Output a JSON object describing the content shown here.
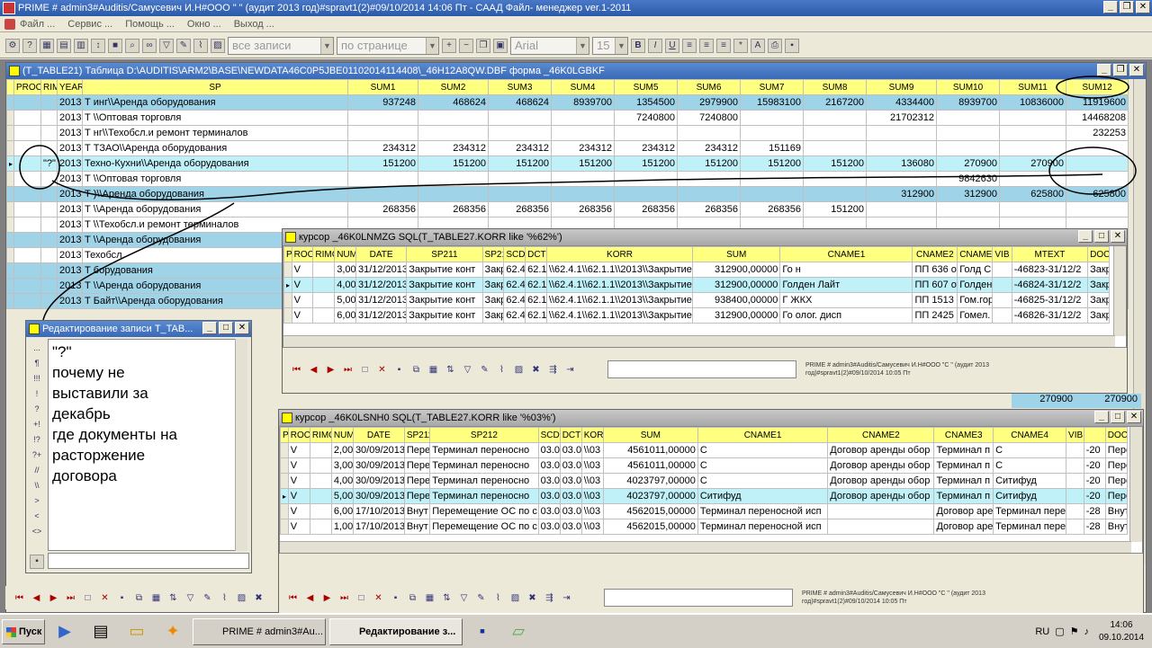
{
  "app": {
    "title": "PRIME # admin3#Auditis/Самусевич И.Н#ООО \"                    \" (аудит 2013 год)#spravt1(2)#09/10/2014 14:06 Пт - СААД Файл- менеджер ver.1-2011"
  },
  "menu": [
    "Файл ...",
    "Сервис ...",
    "Помощь ...",
    "Окно ...",
    "Выход ..."
  ],
  "toolbar": {
    "records": "все записи",
    "page": "по странице",
    "font": "Arial",
    "size": "15"
  },
  "main": {
    "title": "(T_TABLE21) Таблица D:\\AUDITIS\\ARM2\\BASE\\NEWDATA46C0P5JBE01102014114408\\_46H12A8QW.DBF форма _46K0LGBKF",
    "columns": [
      "PROC",
      "RIM",
      "YEAR",
      "SP",
      "SUM1",
      "SUM2",
      "SUM3",
      "SUM4",
      "SUM5",
      "SUM6",
      "SUM7",
      "SUM8",
      "SUM9",
      "SUM10",
      "SUM11",
      "SUM12"
    ],
    "rows": [
      {
        "style": "bl",
        "cells": [
          "",
          "",
          "2013",
          "Т               инг\\\\Аренда оборудования",
          "937248",
          "468624",
          "468624",
          "8939700",
          "1354500",
          "2979900",
          "15983100",
          "2167200",
          "4334400",
          "8939700",
          "10836000",
          "11919600"
        ]
      },
      {
        "style": "",
        "cells": [
          "",
          "",
          "2013",
          "Т                           \\\\Оптовая торговля",
          "",
          "",
          "",
          "",
          "7240800",
          "7240800",
          "",
          "",
          "21702312",
          "",
          "",
          "14468208"
        ]
      },
      {
        "style": "",
        "cells": [
          "",
          "",
          "2013",
          "Т                         нг\\\\Техобсл.и ремонт терминалов",
          "",
          "",
          "",
          "",
          "",
          "",
          "",
          "",
          "",
          "",
          "",
          "232253"
        ]
      },
      {
        "style": "",
        "cells": [
          "",
          "",
          "2013",
          "Т                ТЗАО\\\\Аренда оборудования",
          "234312",
          "234312",
          "234312",
          "234312",
          "234312",
          "234312",
          "151169",
          "",
          "",
          "",
          "",
          ""
        ]
      },
      {
        "style": "hl",
        "cells": [
          "",
          "\"?\"",
          "2013",
          "Техно-Кухни\\\\Аренда оборудования",
          "151200",
          "151200",
          "151200",
          "151200",
          "151200",
          "151200",
          "151200",
          "151200",
          "136080",
          "270900",
          "270900",
          ""
        ]
      },
      {
        "style": "",
        "cells": [
          "",
          "",
          "2013",
          "Т                  \\\\Оптовая торговля",
          "",
          "",
          "",
          "",
          "",
          "",
          "",
          "",
          "",
          "9842630",
          "",
          ""
        ]
      },
      {
        "style": "bl",
        "cells": [
          "",
          "",
          "2013",
          "Т                )\\\\Аренда оборудования",
          "",
          "",
          "",
          "",
          "",
          "",
          "",
          "",
          "312900",
          "312900",
          "625800",
          "625800"
        ]
      },
      {
        "style": "",
        "cells": [
          "",
          "",
          "2013",
          "Т            \\\\Аренда оборудования",
          "268356",
          "268356",
          "268356",
          "268356",
          "268356",
          "268356",
          "268356",
          "151200",
          "",
          "",
          "",
          ""
        ]
      },
      {
        "style": "",
        "cells": [
          "",
          "",
          "2013",
          "Т                \\\\Техобсл.и ремонт терминалов",
          "",
          "",
          "",
          "",
          "",
          "",
          "",
          "",
          "",
          "",
          "",
          ""
        ]
      },
      {
        "style": "bl",
        "cells": [
          "",
          "",
          "2013",
          "Т            \\\\Аренда оборудования",
          "",
          "",
          "",
          "",
          "",
          "",
          "",
          "",
          "",
          "",
          "",
          ""
        ]
      },
      {
        "style": "",
        "cells": [
          "",
          "",
          "2013",
          "Техобсл",
          "",
          "",
          "",
          "",
          "",
          "",
          "",
          "",
          "",
          "",
          "",
          ""
        ]
      },
      {
        "style": "bl",
        "cells": [
          "",
          "",
          "2013",
          "Т                             борудования",
          "",
          "",
          "",
          "",
          "",
          "",
          "",
          "",
          "",
          "",
          "",
          ""
        ]
      },
      {
        "style": "bl",
        "cells": [
          "",
          "",
          "2013",
          "Т        \\\\Аренда оборудования",
          "",
          "",
          "",
          "",
          "",
          "",
          "",
          "",
          "",
          "",
          "",
          ""
        ]
      },
      {
        "style": "bl",
        "cells": [
          "",
          "",
          "2013",
          "Т      Байт\\\\Аренда оборудования",
          "",
          "",
          "",
          "",
          "",
          "",
          "",
          "",
          "",
          "",
          "",
          ""
        ]
      }
    ],
    "row_270900": [
      "270900",
      "270900"
    ]
  },
  "cursor1": {
    "title": "курсор _46K0LNMZG SQL(T_TABLE27.KORR like '%62%')",
    "columns": [
      "P",
      "ROC",
      "RIMC",
      "NUM",
      "DATE",
      "SP211",
      "SP21",
      "SCD",
      "DCT",
      "KORR",
      "SUM",
      "CNAME1",
      "CNAME2",
      "CNAME3",
      "VIB",
      "MTEXT",
      "DOC"
    ],
    "rows": [
      {
        "style": "",
        "cells": [
          "",
          "V",
          "",
          "3,00",
          "31/12/2013",
          "Закрытие конт",
          "Закр",
          "62.4",
          "62.1",
          "\\\\62.4.1\\\\62.1.1\\\\2013\\\\Закрытие",
          "312900,00000",
          "Го              н",
          "ПП 636 от",
          "Голд С",
          "",
          "-46823-31/12/2",
          "Закр"
        ]
      },
      {
        "style": "hl",
        "cells": [
          "▸",
          "V",
          "",
          "4,00",
          "31/12/2013",
          "Закрытие конт",
          "Закр",
          "62.4",
          "62.1",
          "\\\\62.4.1\\\\62.1.1\\\\2013\\\\Закрытие",
          "312900,00000",
          "Голден Лайт",
          "ПП 607 от",
          "Голден",
          "",
          "-46824-31/12/2",
          "Закр"
        ]
      },
      {
        "style": "",
        "cells": [
          "",
          "V",
          "",
          "5,00",
          "31/12/2013",
          "Закрытие конт",
          "Закр",
          "62.4",
          "62.1",
          "\\\\62.4.1\\\\62.1.1\\\\2013\\\\Закрытие",
          "938400,00000",
          "Г                  ЖКХ",
          "ПП 1513 о",
          "Гом.гор",
          "",
          "-46825-31/12/2",
          "Закр"
        ]
      },
      {
        "style": "",
        "cells": [
          "",
          "V",
          "",
          "6,00",
          "31/12/2013",
          "Закрытие конт",
          "Закр",
          "62.4",
          "62.1",
          "\\\\62.4.1\\\\62.1.1\\\\2013\\\\Закрытие",
          "312900,00000",
          "Го            олог. дисп",
          "ПП 2425 о",
          "Гомел.",
          "",
          "-46826-31/12/2",
          "Закр"
        ]
      }
    ],
    "status": "PRIME # admin3#Auditis/Самусевич И.Н#ООО \"С                       \" (аудит 2013 год)#spravt1(2)#09/10/2014 10:05 Пт"
  },
  "cursor2": {
    "title": "курсор _46K0LSNH0 SQL(T_TABLE27.KORR like '%03%')",
    "columns": [
      "P",
      "ROC",
      "RIMC",
      "NUM",
      "DATE",
      "SP211",
      "SP212",
      "SCD",
      "DCT",
      "KORR",
      "SUM",
      "CNAME1",
      "CNAME2",
      "CNAME3",
      "CNAME4",
      "VIB",
      "",
      "DOC"
    ],
    "rows": [
      {
        "style": "",
        "cells": [
          "",
          "V",
          "",
          "2,00",
          "30/09/2013",
          "Пере",
          "Терминал переносно",
          "03.0",
          "03.0",
          "\\\\03",
          "4561011,00000",
          "С       ",
          "Договор аренды обор",
          "Терминал п",
          "С        ",
          "",
          "-20",
          "Пере"
        ]
      },
      {
        "style": "",
        "cells": [
          "",
          "V",
          "",
          "3,00",
          "30/09/2013",
          "Пере",
          "Терминал переносно",
          "03.0",
          "03.0",
          "\\\\03",
          "4561011,00000",
          "С      ",
          "Договор аренды обор",
          "Терминал п",
          "С        ",
          "",
          "-20",
          "Пере"
        ]
      },
      {
        "style": "",
        "cells": [
          "",
          "V",
          "",
          "4,00",
          "30/09/2013",
          "Пере",
          "Терминал переносно",
          "03.0",
          "03.0",
          "\\\\03",
          "4023797,00000",
          "С",
          "Договор аренды обор",
          "Терминал п",
          "Ситифуд",
          "",
          "-20",
          "Пере"
        ]
      },
      {
        "style": "hl",
        "cells": [
          "▸",
          "V",
          "",
          "5,00",
          "30/09/2013",
          "Пере",
          "Терминал переносно",
          "03.0",
          "03.0",
          "\\\\03",
          "4023797,00000",
          "Ситифуд",
          "Договор аренды обор",
          "Терминал п",
          "Ситифуд",
          "",
          "-20",
          "Пере"
        ]
      },
      {
        "style": "",
        "cells": [
          "",
          "V",
          "",
          "6,00",
          "17/10/2013",
          "Внут",
          "Перемещение ОС по с",
          "03.0",
          "03.0",
          "\\\\03",
          "4562015,00000",
          "Терминал переносной исп",
          "",
          "Договор аре",
          "Терминал пере",
          "",
          "-28",
          "Внут"
        ]
      },
      {
        "style": "",
        "cells": [
          "",
          "V",
          "",
          "1,00",
          "17/10/2013",
          "Внут",
          "Перемещение ОС по с",
          "03.0",
          "03.0",
          "\\\\03",
          "4562015,00000",
          "Терминал переносной исп",
          "",
          "Договор аре",
          "Терминал пере",
          "",
          "-28",
          "Внут"
        ]
      }
    ],
    "status": "PRIME # admin3#Auditis/Самусевич И.Н#ООО \"С                      \" (аудит 2013 год)#spravt1(2)#09/10/2014 10:05 Пт"
  },
  "editor": {
    "title": "Редактирование записи T_TAB...",
    "text": "\"?\"\nпочему не\nвыставили за\nдекабрь\nгде документы на\nрасторжение\nдоговора",
    "buttons": [
      "...",
      "¶",
      "!!!",
      "!",
      "?",
      "+!",
      "!?",
      "?+",
      "//",
      "\\\\",
      ">",
      "<",
      "<>"
    ]
  },
  "taskbar": {
    "start": "Пуск",
    "tasks": [
      "PRIME # admin3#Au...",
      "Редактирование з..."
    ],
    "lang": "RU",
    "time": "14:06",
    "date": "09.10.2014"
  }
}
